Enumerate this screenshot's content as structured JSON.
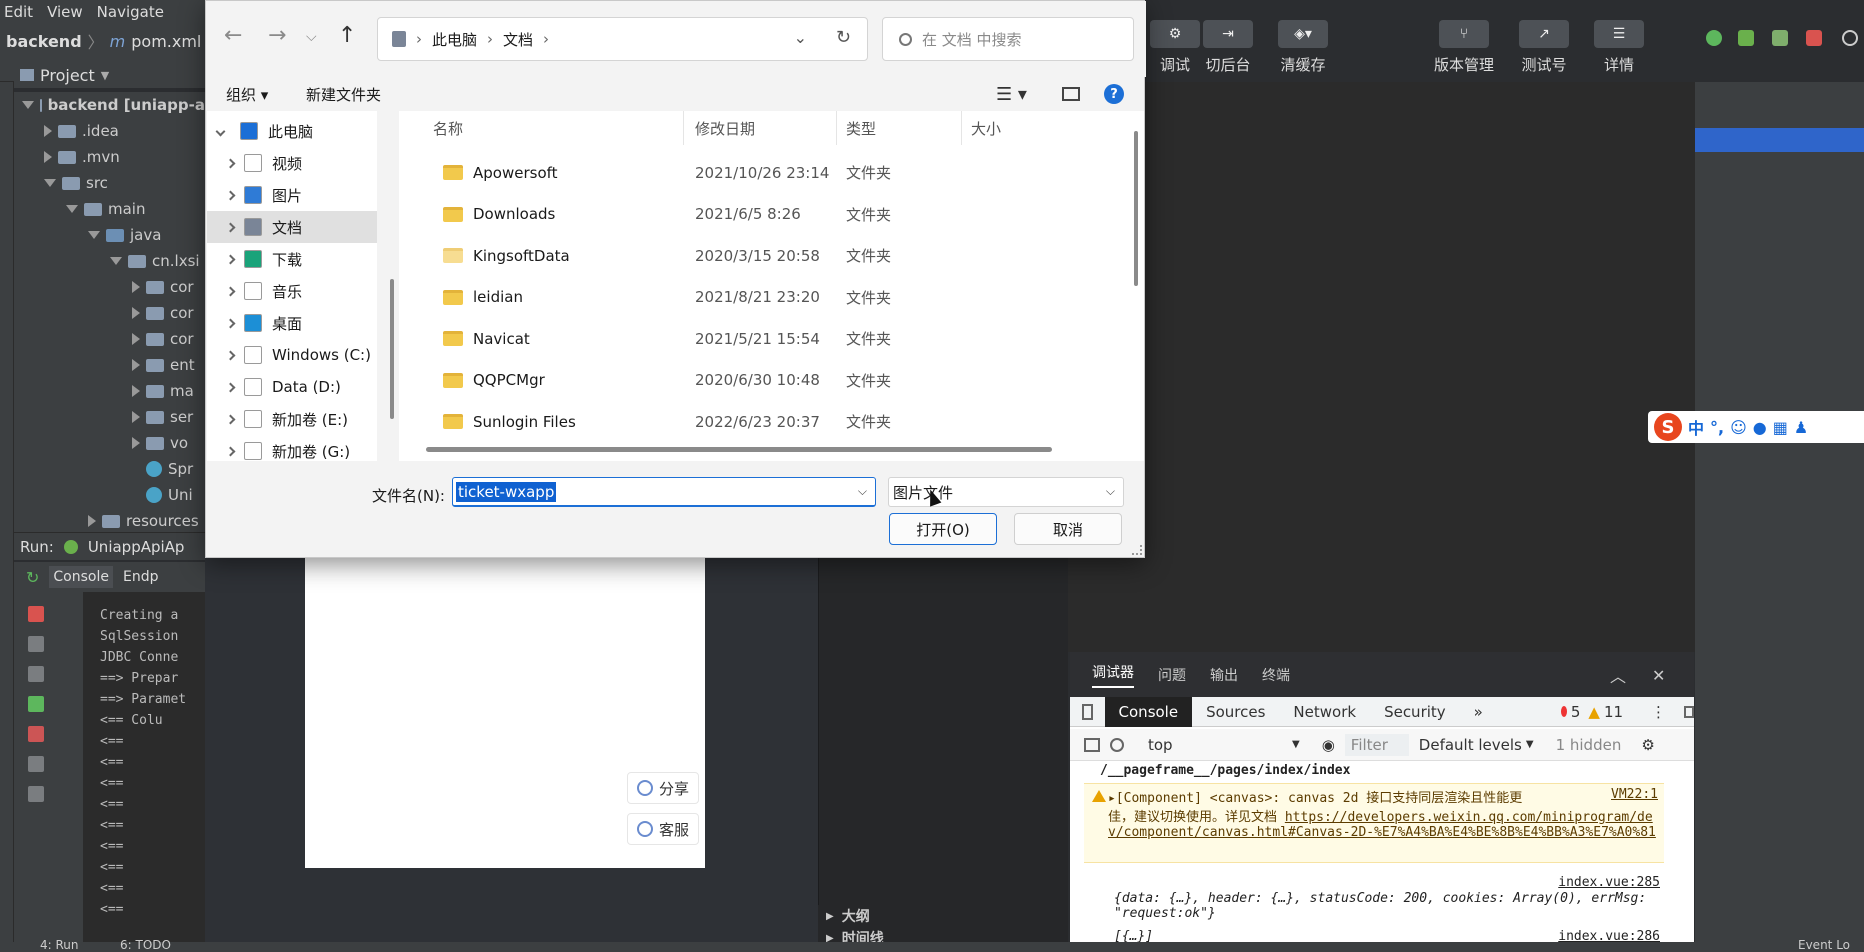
{
  "ide": {
    "menu": [
      "Edit",
      "View",
      "Navigate"
    ],
    "breadcrumb": {
      "project": "backend",
      "file": "pom.xml"
    },
    "project_label": "Project",
    "tree": [
      {
        "label": "backend [uniapp-a",
        "depth": 0,
        "kind": "folder-open",
        "bold": true
      },
      {
        "label": ".idea",
        "depth": 1,
        "kind": "folder"
      },
      {
        "label": ".mvn",
        "depth": 1,
        "kind": "folder"
      },
      {
        "label": "src",
        "depth": 1,
        "kind": "folder-open"
      },
      {
        "label": "main",
        "depth": 2,
        "kind": "folder-open"
      },
      {
        "label": "java",
        "depth": 3,
        "kind": "folder-open-blue"
      },
      {
        "label": "cn.lxsi",
        "depth": 4,
        "kind": "folder-open"
      },
      {
        "label": "cor",
        "depth": 5,
        "kind": "folder"
      },
      {
        "label": "cor",
        "depth": 5,
        "kind": "folder"
      },
      {
        "label": "cor",
        "depth": 5,
        "kind": "folder"
      },
      {
        "label": "ent",
        "depth": 5,
        "kind": "folder"
      },
      {
        "label": "ma",
        "depth": 5,
        "kind": "folder"
      },
      {
        "label": "ser",
        "depth": 5,
        "kind": "folder"
      },
      {
        "label": "vo",
        "depth": 5,
        "kind": "folder"
      },
      {
        "label": "Spr",
        "depth": 5,
        "kind": "class"
      },
      {
        "label": "Uni",
        "depth": 5,
        "kind": "class"
      },
      {
        "label": "resources",
        "depth": 3,
        "kind": "folder"
      }
    ],
    "run_label": "Run:",
    "run_config": "UniappApiAp",
    "console_tabs": [
      "Console",
      "Endp"
    ],
    "console_lines": [
      "Creating a",
      "SqlSession",
      "JDBC Conne",
      "==>  Prepar",
      "==> Paramet",
      "<==    Colu",
      "<==",
      "<==",
      "<==",
      "<==",
      "<==",
      "<==",
      "<==",
      "<==",
      "<=="
    ],
    "status_run": "4: Run",
    "status_todo": "6: TODO",
    "status_event": "Event Lo"
  },
  "simulator": {
    "share": "分享",
    "service": "客服"
  },
  "outline": [
    "大纲",
    "时间线"
  ],
  "toolbar": [
    {
      "label": "调试",
      "icon": "debug-icon"
    },
    {
      "label": "切后台",
      "icon": "switch-bg-icon"
    },
    {
      "label": "清缓存",
      "icon": "clear-cache-icon"
    },
    {
      "label": "版本管理",
      "icon": "version-icon"
    },
    {
      "label": "测试号",
      "icon": "test-account-icon"
    },
    {
      "label": "详情",
      "icon": "details-icon"
    }
  ],
  "devtools": {
    "top_tabs": [
      "调试器",
      "问题",
      "输出",
      "终端"
    ],
    "panel_tabs": [
      "Console",
      "Sources",
      "Network",
      "Security",
      "»"
    ],
    "errors": "5",
    "warnings": "11",
    "context": "top",
    "filter_placeholder": "Filter",
    "levels": "Default levels",
    "hidden": "1 hidden",
    "console": {
      "path": "/__pageframe__/pages/index/index",
      "warn_prefix": "▸[Component] <canvas>: canvas 2d 接口支持同层渲染且性能更",
      "warn_src": "VM22:1",
      "warn_line2": "佳，建议切换使用。详见文档",
      "warn_link": "https://developers.weixin.qq.com/miniprogram/dev/component/canvas.html#Canvas-2D-%E7%A4%BA%E4%BE%8B%E4%BB%A3%E7%A0%81",
      "log1_src": "index.vue:285",
      "log1": "{data: {…}, header: {…}, statusCode: 200, cookies: Array(0), errMsg: \"request:ok\"}",
      "log2_src": "index.vue:286",
      "log2": "[{…}]"
    }
  },
  "dialog": {
    "breadcrumb": [
      "此电脑",
      "文档"
    ],
    "search_placeholder": "在 文档 中搜索",
    "organize": "组织 ▾",
    "new_folder": "新建文件夹",
    "nav": [
      {
        "label": "此电脑",
        "icon": "pc-icon",
        "color": "#1c6fd6",
        "expanded": true
      },
      {
        "label": "视频",
        "icon": "video-icon",
        "color": "#ffffff"
      },
      {
        "label": "图片",
        "icon": "pictures-icon",
        "color": "#2f7bd6"
      },
      {
        "label": "文档",
        "icon": "documents-icon",
        "color": "#7a8597",
        "selected": true
      },
      {
        "label": "下载",
        "icon": "download-icon",
        "color": "#1aa37a"
      },
      {
        "label": "音乐",
        "icon": "music-icon",
        "color": "#ffffff"
      },
      {
        "label": "桌面",
        "icon": "desktop-icon",
        "color": "#1c8fd6"
      },
      {
        "label": "Windows (C:)",
        "icon": "drive-icon",
        "color": "#ffffff"
      },
      {
        "label": "Data (D:)",
        "icon": "drive-icon",
        "color": "#ffffff"
      },
      {
        "label": "新加卷 (E:)",
        "icon": "drive-icon",
        "color": "#ffffff"
      },
      {
        "label": "新加卷 (G:)",
        "icon": "drive-icon",
        "color": "#ffffff"
      }
    ],
    "columns": [
      "名称",
      "修改日期",
      "类型",
      "大小"
    ],
    "files": [
      {
        "name": "Apowersoft",
        "date": "2021/10/26 23:14",
        "type": "文件夹"
      },
      {
        "name": "Downloads",
        "date": "2021/6/5 8:26",
        "type": "文件夹"
      },
      {
        "name": "KingsoftData",
        "date": "2020/3/15 20:58",
        "type": "文件夹",
        "light": true
      },
      {
        "name": "leidian",
        "date": "2021/8/21 23:20",
        "type": "文件夹"
      },
      {
        "name": "Navicat",
        "date": "2021/5/21 15:54",
        "type": "文件夹"
      },
      {
        "name": "QQPCMgr",
        "date": "2020/6/30 10:48",
        "type": "文件夹"
      },
      {
        "name": "Sunlogin Files",
        "date": "2022/6/23 20:37",
        "type": "文件夹"
      }
    ],
    "filename_label": "文件名(N):",
    "filename_value": "ticket-wxapp",
    "filetype": "图片文件",
    "open": "打开(O)",
    "cancel": "取消"
  },
  "ime": {
    "logo": "S",
    "mode": "中",
    "punct": "°,"
  }
}
